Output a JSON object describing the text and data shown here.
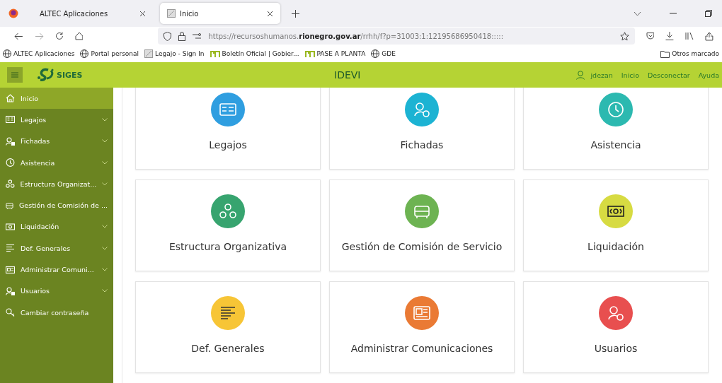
{
  "browser": {
    "tabs": [
      {
        "title": "ALTEC Aplicaciones",
        "selected": false
      },
      {
        "title": "Inicio",
        "selected": true
      }
    ],
    "url_host": "https://recursoshumanos.",
    "url_domain": "rionegro.gov.ar",
    "url_path": "/rrhh/f?p=31003:1:12195686950418:::::",
    "bookmarks": [
      {
        "label": "ALTEC Aplicaciones",
        "kind": "globe"
      },
      {
        "label": "Portal personal",
        "kind": "globe"
      },
      {
        "label": "Legajo - Sign In",
        "kind": "page"
      },
      {
        "label": "Boletín Oficial | Gobier...",
        "kind": "rn"
      },
      {
        "label": "PASE A PLANTA",
        "kind": "rn"
      },
      {
        "label": "GDE",
        "kind": "globe"
      }
    ],
    "other_bookmarks": "Otros marcado"
  },
  "header": {
    "logo": "SIGES",
    "title": "IDEVI",
    "user": "jdezan",
    "links": [
      "Inicio",
      "Desconectar",
      "Ayuda"
    ]
  },
  "sidebar": {
    "items": [
      {
        "label": "Inicio",
        "selected": true,
        "has_submenu": false
      },
      {
        "label": "Legajos",
        "selected": false,
        "has_submenu": true
      },
      {
        "label": "Fichadas",
        "selected": false,
        "has_submenu": true
      },
      {
        "label": "Asistencia",
        "selected": false,
        "has_submenu": true
      },
      {
        "label": "Estructura Organizat...",
        "selected": false,
        "has_submenu": true
      },
      {
        "label": "Gestión de Comisión de ...",
        "selected": false,
        "has_submenu": false
      },
      {
        "label": "Liquidación",
        "selected": false,
        "has_submenu": true
      },
      {
        "label": "Def. Generales",
        "selected": false,
        "has_submenu": true
      },
      {
        "label": "Administrar Comuni...",
        "selected": false,
        "has_submenu": true
      },
      {
        "label": "Usuarios",
        "selected": false,
        "has_submenu": true
      },
      {
        "label": "Cambiar contraseña",
        "selected": false,
        "has_submenu": false
      }
    ]
  },
  "cards": [
    {
      "label": "Legajos",
      "color": "#2f9ee0"
    },
    {
      "label": "Fichadas",
      "color": "#1cb3d3"
    },
    {
      "label": "Asistencia",
      "color": "#2cb9b0"
    },
    {
      "label": "Estructura Organizativa",
      "color": "#37a46f"
    },
    {
      "label": "Gestión de Comisión de Servicio",
      "color": "#6db352"
    },
    {
      "label": "Liquidación",
      "color": "#d7db42"
    },
    {
      "label": "Def. Generales",
      "color": "#f7c536"
    },
    {
      "label": "Administrar Comunicaciones",
      "color": "#ea7a34"
    },
    {
      "label": "Usuarios",
      "color": "#e84f4f"
    }
  ]
}
